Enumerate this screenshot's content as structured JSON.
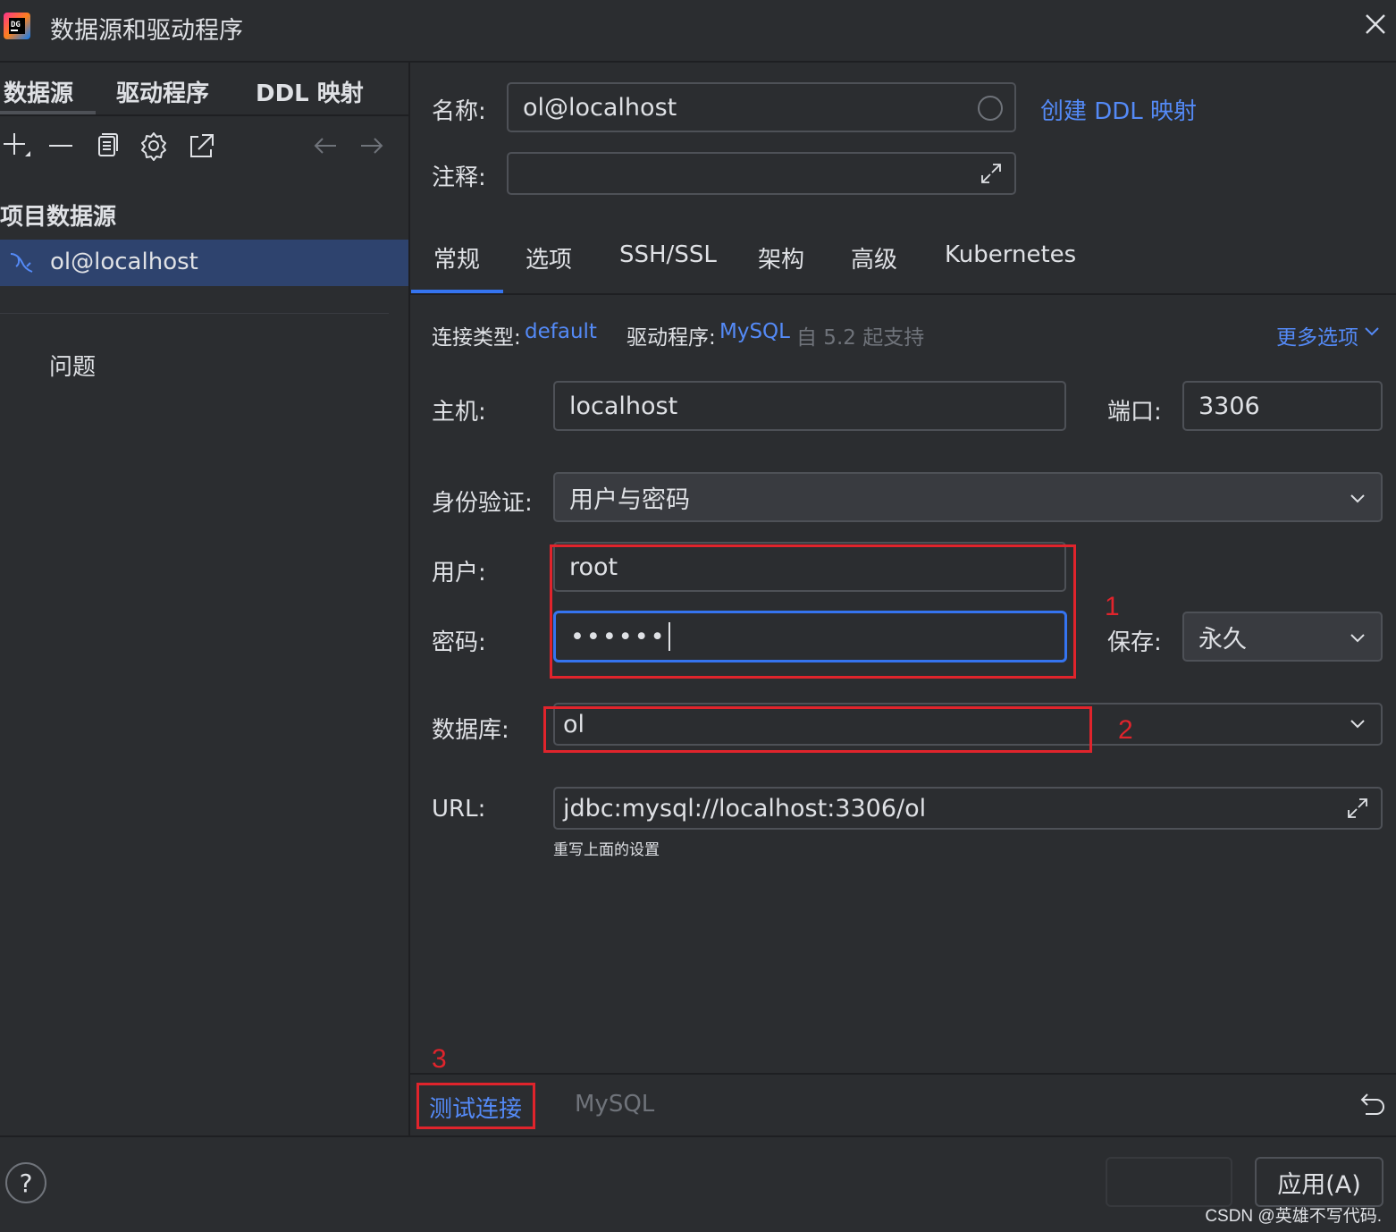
{
  "window": {
    "title": "数据源和驱动程序",
    "close_icon": "close-icon"
  },
  "left": {
    "tabs": [
      "数据源",
      "驱动程序",
      "DDL 映射"
    ],
    "active_tab": "数据源",
    "toolbar_icons": [
      "add-icon",
      "remove-icon",
      "copy-icon",
      "gear-icon",
      "open-external-icon",
      "back-arrow-icon",
      "forward-arrow-icon"
    ],
    "section_title": "项目数据源",
    "datasources": [
      {
        "label": "ol@localhost",
        "icon": "mysql-dolphin-icon",
        "selected": true
      }
    ],
    "problems_label": "问题"
  },
  "form": {
    "name_label": "名称:",
    "name_value": "ol@localhost",
    "create_ddl_link": "创建 DDL 映射",
    "comment_label": "注释:",
    "comment_value": "",
    "tabs": [
      "常规",
      "选项",
      "SSH/SSL",
      "架构",
      "高级",
      "Kubernetes"
    ],
    "active_tab": "常规",
    "conn_type_label": "连接类型:",
    "conn_type_value": "default",
    "driver_label": "驱动程序:",
    "driver_value": "MySQL",
    "driver_note": "自 5.2 起支持",
    "more_options": "更多选项",
    "host_label": "主机:",
    "host_value": "localhost",
    "port_label": "端口:",
    "port_value": "3306",
    "auth_label": "身份验证:",
    "auth_value": "用户与密码",
    "user_label": "用户:",
    "user_value": "root",
    "password_label": "密码:",
    "password_value": "••••••",
    "save_label": "保存:",
    "save_value": "永久",
    "database_label": "数据库:",
    "database_value": "ol",
    "url_label": "URL:",
    "url_value": "jdbc:mysql://localhost:3306/ol",
    "url_hint": "重写上面的设置"
  },
  "annotations": [
    "1",
    "2",
    "3"
  ],
  "bottom": {
    "test_connection": "测试连接",
    "driver_name": "MySQL",
    "revert_icon": "undo-icon"
  },
  "footer": {
    "help": "?",
    "apply_button": "应用(A)",
    "watermark": "CSDN @英雄不写代码."
  },
  "colors": {
    "background": "#2b2d30",
    "selection": "#2e436e",
    "accent": "#548af7",
    "focus": "#3574f0",
    "annotation": "#e0242c"
  }
}
